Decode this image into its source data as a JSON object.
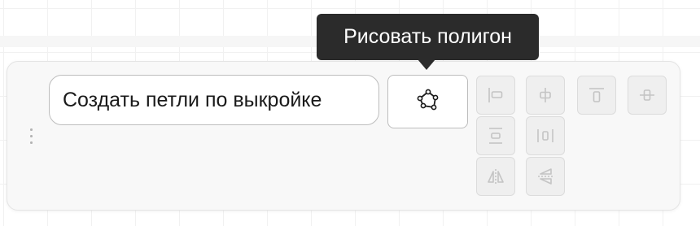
{
  "tooltip": {
    "text": "Рисовать полигон"
  },
  "field": {
    "value": "Создать петли по выкройке"
  },
  "icons": {
    "drag": "vertical-dots-icon",
    "polygon": "polygon-draw-icon",
    "align_left": "align-left-icon",
    "align_center_h": "align-horizontal-center-icon",
    "align_top": "align-top-icon",
    "align_center_v": "align-vertical-center-icon",
    "distribute_v": "distribute-vertical-icon",
    "distribute_h": "distribute-horizontal-icon",
    "flip_h": "flip-horizontal-icon",
    "flip_v": "flip-vertical-icon"
  },
  "colors": {
    "tooltip_bg": "#2b2b2b",
    "panel_bg": "#f8f8f8",
    "disabled_icon": "#c4c4c4"
  }
}
